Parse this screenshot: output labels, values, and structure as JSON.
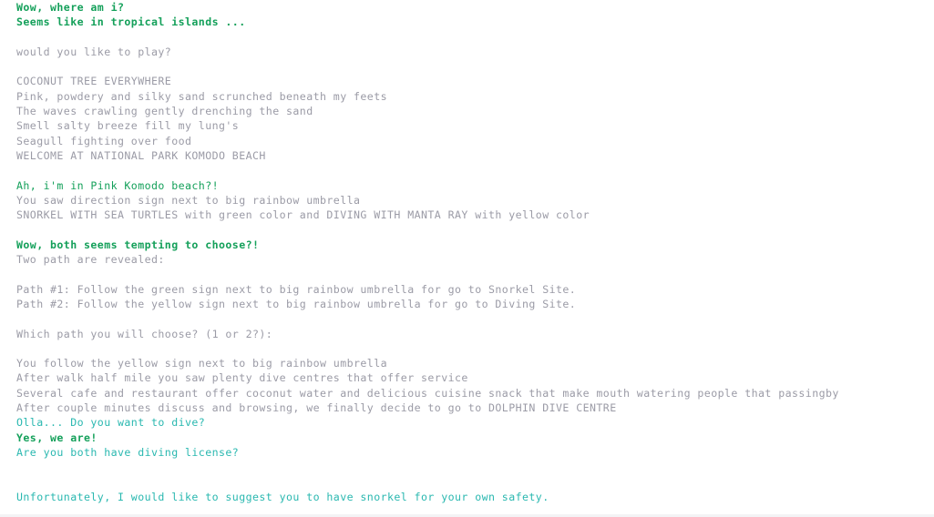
{
  "colors": {
    "bold_green": "#14a05a",
    "green": "#14a05a",
    "gray": "#9b9ba6",
    "teal": "#2ab8b0"
  },
  "console": {
    "lines": [
      {
        "text": "Wow, where am i?",
        "style": "bold_green"
      },
      {
        "text": "Seems like in tropical islands ...",
        "style": "bold_green"
      },
      {
        "text": "",
        "style": "gray"
      },
      {
        "text": "would you like to play?",
        "style": "gray"
      },
      {
        "text": "",
        "style": "gray"
      },
      {
        "text": "COCONUT TREE EVERYWHERE",
        "style": "gray"
      },
      {
        "text": "Pink, powdery and silky sand scrunched beneath my feets",
        "style": "gray"
      },
      {
        "text": "The waves crawling gently drenching the sand",
        "style": "gray"
      },
      {
        "text": "Smell salty breeze fill my lung's",
        "style": "gray"
      },
      {
        "text": "Seagull fighting over food",
        "style": "gray"
      },
      {
        "text": "WELCOME AT NATIONAL PARK KOMODO BEACH",
        "style": "gray"
      },
      {
        "text": "",
        "style": "gray"
      },
      {
        "text": "Ah, i'm in Pink Komodo beach?!",
        "style": "green"
      },
      {
        "text": "You saw direction sign next to big rainbow umbrella",
        "style": "gray"
      },
      {
        "text": "SNORKEL WITH SEA TURTLES with green color and DIVING WITH MANTA RAY with yellow color",
        "style": "gray"
      },
      {
        "text": "",
        "style": "gray"
      },
      {
        "text": "Wow, both seems tempting to choose?!",
        "style": "bold_green"
      },
      {
        "text": "Two path are revealed:",
        "style": "gray"
      },
      {
        "text": "",
        "style": "gray"
      },
      {
        "text": "Path #1: Follow the green sign next to big rainbow umbrella for go to Snorkel Site.",
        "style": "gray"
      },
      {
        "text": "Path #2: Follow the yellow sign next to big rainbow umbrella for go to Diving Site.",
        "style": "gray"
      },
      {
        "text": "",
        "style": "gray"
      },
      {
        "text": "Which path you will choose? (1 or 2?):",
        "style": "gray"
      },
      {
        "text": "",
        "style": "gray"
      },
      {
        "text": "You follow the yellow sign next to big rainbow umbrella",
        "style": "gray"
      },
      {
        "text": "After walk half mile you saw plenty dive centres that offer service",
        "style": "gray"
      },
      {
        "text": "Several cafe and restaurant offer coconut water and delicious cuisine snack that make mouth watering people that passingby",
        "style": "gray"
      },
      {
        "text": "After couple minutes discuss and browsing, we finally decide to go to DOLPHIN DIVE CENTRE",
        "style": "gray"
      },
      {
        "text": "Olla... Do you want to dive?",
        "style": "teal"
      },
      {
        "text": "Yes, we are!",
        "style": "bold_green"
      },
      {
        "text": "Are you both have diving license?",
        "style": "teal"
      },
      {
        "text": "",
        "style": "gray"
      },
      {
        "text": "",
        "style": "gray"
      },
      {
        "text": "Unfortunately, I would like to suggest you to have snorkel for your own safety.",
        "style": "teal"
      }
    ]
  }
}
